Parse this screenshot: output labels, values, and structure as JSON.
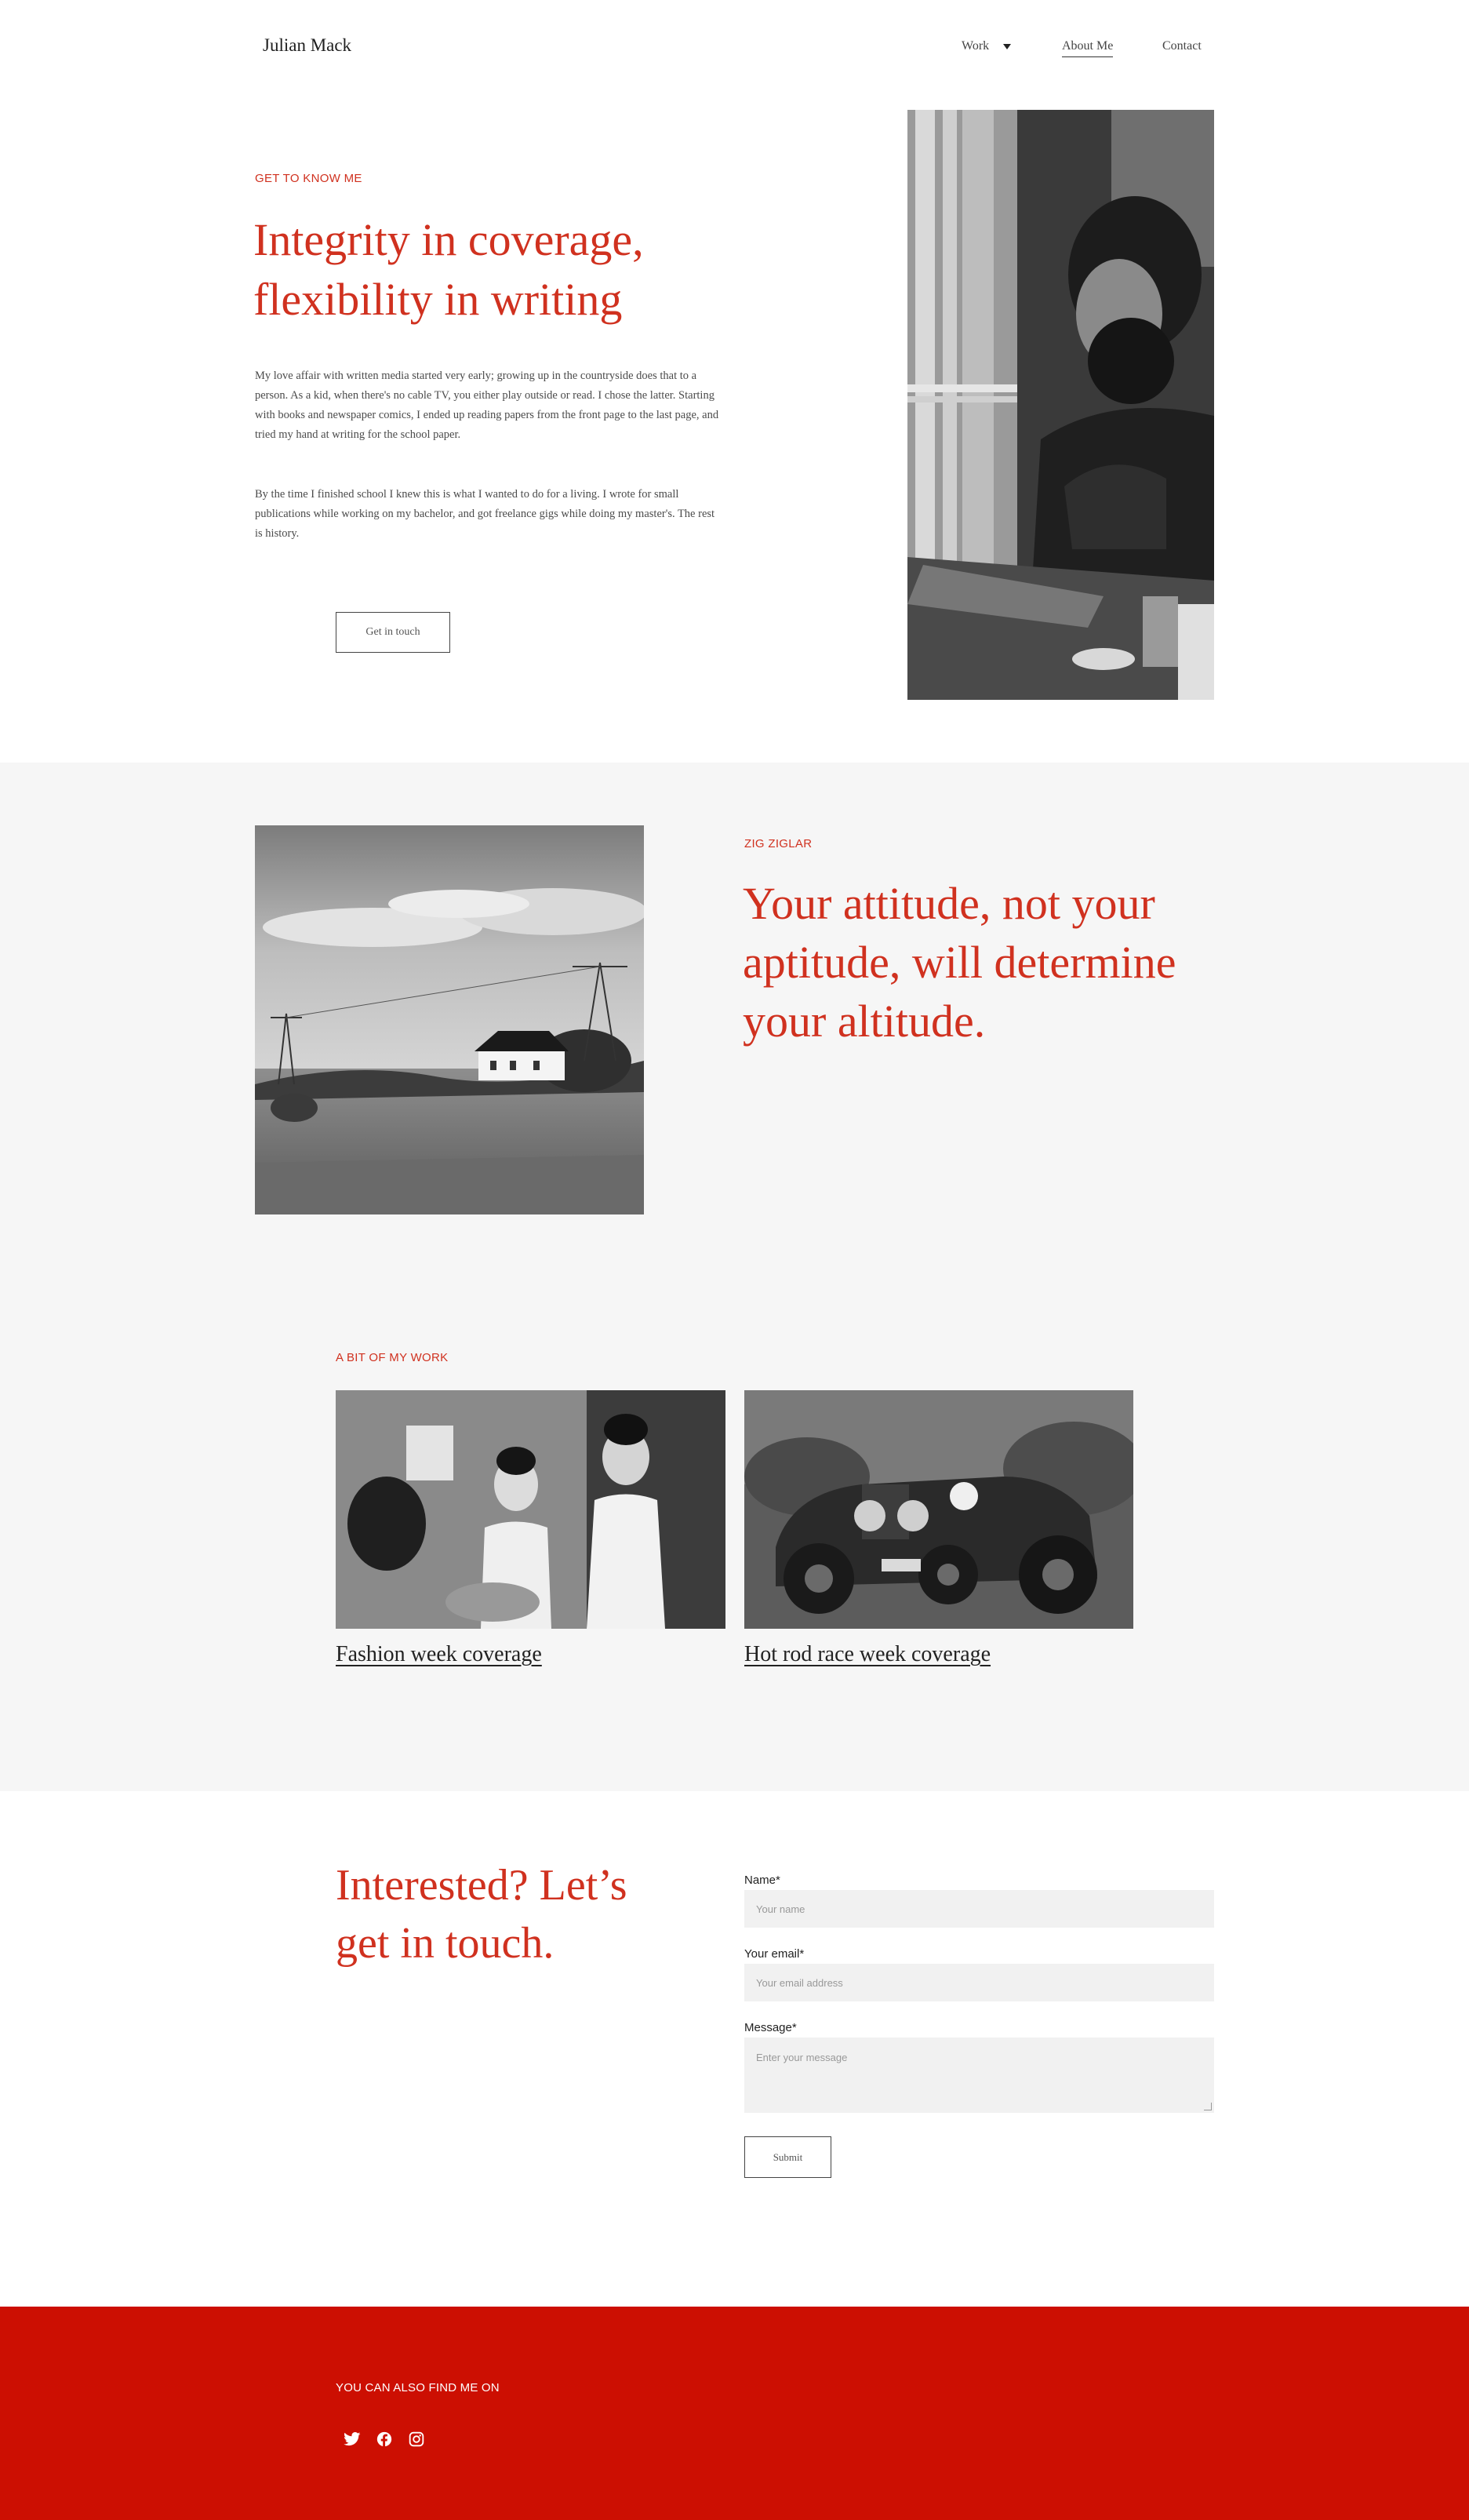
{
  "header": {
    "brand": "Julian Mack",
    "nav": {
      "work": "Work",
      "about": "About Me",
      "contact": "Contact"
    }
  },
  "hero": {
    "eyebrow": "GET TO KNOW ME",
    "title": "Integrity in coverage, flexibility in writing",
    "paragraph1": "My love affair with written media started very early; growing up in the countryside does that to a person. As a kid, when there's no cable TV, you either play outside or read. I chose the latter. Starting with books and newspaper comics, I ended up reading papers from the front page to the last page, and tried my hand at writing for the school paper.",
    "paragraph2": "By the time I finished school I knew this is what I wanted to do for a living. I wrote for small publications while working on my bachelor, and got freelance gigs while doing my master's. The rest is history.",
    "button": "Get in touch"
  },
  "quote": {
    "eyebrow": "ZIG ZIGLAR",
    "text": "Your attitude, not your aptitude, will determine your altitude."
  },
  "work": {
    "eyebrow": "A BIT OF MY WORK",
    "items": [
      {
        "title": "Fashion week coverage"
      },
      {
        "title": "Hot rod race week coverage"
      }
    ]
  },
  "contact": {
    "title": "Interested? Let’s get in touch.",
    "name_label": "Name*",
    "name_placeholder": "Your name",
    "email_label": "Your email*",
    "email_placeholder": "Your email address",
    "message_label": "Message*",
    "message_placeholder": "Enter your message",
    "submit": "Submit"
  },
  "footer": {
    "label": "YOU CAN ALSO FIND ME ON",
    "icons": [
      "twitter-icon",
      "facebook-icon",
      "instagram-icon"
    ]
  },
  "colors": {
    "accent": "#d0311f",
    "footer_bg": "#cc0f02",
    "band_bg": "#f6f6f6",
    "field_bg": "#f1f1f1"
  }
}
